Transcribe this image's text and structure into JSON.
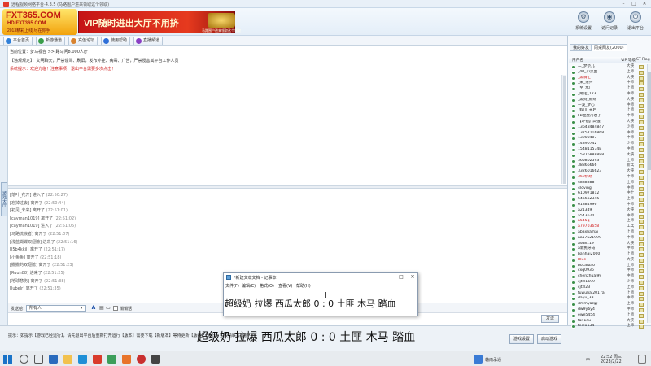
{
  "window": {
    "title": "远程视频网络平台-4.3.5 (马路围户进来领取这个领取)"
  },
  "logo": {
    "main": "FXT365.COM",
    "url": "HD.FXT365.COM",
    "sub": "2013精彩上线 尽在你手"
  },
  "ad_banner": {
    "text": "VIP随时进出大厅不用挤",
    "badge_caption": "马路围户进来领取这个领取"
  },
  "top_actions": [
    {
      "label": "系统设置",
      "icon": "gear-icon"
    },
    {
      "label": "访问记录",
      "icon": "record-icon"
    },
    {
      "label": "退出平台",
      "icon": "exit-icon"
    }
  ],
  "tabs": [
    {
      "label": "平台首页",
      "color": "#2f7fd8"
    },
    {
      "label": "新游通道",
      "color": "#3a9e4a"
    },
    {
      "label": "充值论坛",
      "color": "#d8832f"
    },
    {
      "label": "使用帮助",
      "color": "#2f6fd8"
    },
    {
      "label": "直播频道",
      "color": "#8a3fc4"
    }
  ],
  "left_side_tab": "游戏大厅",
  "chat": {
    "position": "当前位置：梦马视台 >> 路马问8.000人厅",
    "rules": "【违规规定】：文明聊天，严禁谩骂、刷屏，发布外挂、病毒、广告，严禁侵害其平台工作人员",
    "notice": "系统提示：欢迎光临！注意事项：退出平台需要多次点击！",
    "log": [
      {
        "name": "[落叶_花开]",
        "action": "进入了",
        "time": "(22:50:27)"
      },
      {
        "name": "[忘掉过去]",
        "action": "离开了",
        "time": "(22:50:44)"
      },
      {
        "name": "[初见_未来]",
        "action": "离开了",
        "time": "(22:51:01)"
      },
      {
        "name": "[cayman1019]",
        "action": "离开了",
        "time": "(22:51:02)"
      },
      {
        "name": "[cayman1019]",
        "action": "进入了",
        "time": "(22:51:05)"
      },
      {
        "name": "[马路流浪者]",
        "action": "离开了",
        "time": "(22:51:07)"
      },
      {
        "name": "[浅蓝蝴蝶双翅膀]",
        "action": "进来了",
        "time": "(22:51:16)"
      },
      {
        "name": "[l5b4kkjl]",
        "action": "离开了",
        "time": "(22:51:17)"
      },
      {
        "name": "[小鱼鱼]",
        "action": "离开了",
        "time": "(22:51:18)"
      },
      {
        "name": "[撒撒的双翅膀]",
        "action": "离开了",
        "time": "(22:51:23)"
      },
      {
        "name": "[Ruuh88]",
        "action": "进来了",
        "time": "(22:51:25)"
      },
      {
        "name": "[地球悲伤]",
        "action": "离开了",
        "time": "(22:51:38)"
      },
      {
        "name": "[lubelr]",
        "action": "离开了",
        "time": "(22:51:35)"
      }
    ]
  },
  "send_row": {
    "label": "发送给：",
    "target": "所有人",
    "private_label": "悄悄话",
    "send_button": "发送"
  },
  "bottom": {
    "tip": "提示：如提示【游戏已经运行】，请先退出平台后重新打开运行【版本】需要下载【新版本】等待更新【版本】【运行】失败请联系客服",
    "buttons": [
      "游戏设置",
      "启动游戏"
    ]
  },
  "right_panel": {
    "tabs": [
      "我的好友",
      "同桌网友(2000)"
    ],
    "headers": {
      "name": "用户名",
      "level": "VIP 等级",
      "status": "ST-Flag"
    },
    "users": [
      {
        "name": "二_梦奈儿",
        "level": "大侠",
        "red": false
      },
      {
        "name": "_40_小黑面",
        "level": "上师",
        "red": false
      },
      {
        "name": "_黑骑士",
        "level": "大侠",
        "red": true
      },
      {
        "name": "_某_余兴",
        "level": "中师",
        "red": false
      },
      {
        "name": "_至_水广",
        "level": "上师",
        "red": false
      },
      {
        "name": "_踢诺_123",
        "level": "中师",
        "red": false
      },
      {
        "name": "_黑狗_教练",
        "level": "大侠",
        "red": false
      },
      {
        "name": "一波_梦心",
        "level": "中师",
        "red": false
      },
      {
        "name": "_假川_天启",
        "level": "上师",
        "red": false
      },
      {
        "name": "FB金虎丹君子",
        "level": "中师",
        "red": false
      },
      {
        "name": "【环锁】高强",
        "level": "大侠",
        "red": false
      },
      {
        "name": "13648484847",
        "level": "少师",
        "red": false
      },
      {
        "name": "13757116868",
        "level": "中师",
        "red": false
      },
      {
        "name": "13900407",
        "level": "中师",
        "red": false
      },
      {
        "name": "14390742",
        "level": "少师",
        "red": false
      },
      {
        "name": "154811574B",
        "level": "中师",
        "red": false
      },
      {
        "name": "15876888888",
        "level": "大侠",
        "red": false
      },
      {
        "name": "365802593",
        "level": "上师",
        "red": false
      },
      {
        "name": "38866666",
        "level": "新兵",
        "red": false
      },
      {
        "name": "3326016623",
        "level": "大侠",
        "red": false
      },
      {
        "name": "369机场",
        "level": "中师",
        "red": true
      },
      {
        "name": "4888888",
        "level": "上师",
        "red": false
      },
      {
        "name": "4loving",
        "level": "中师",
        "red": false
      },
      {
        "name": "610971812",
        "level": "中士",
        "red": false
      },
      {
        "name": "646662345",
        "level": "上师",
        "red": false
      },
      {
        "name": "61884996",
        "level": "中师",
        "red": false
      },
      {
        "name": "a21349",
        "level": "大侠",
        "red": false
      },
      {
        "name": "a543620",
        "level": "中师",
        "red": false
      },
      {
        "name": "a545q",
        "level": "上师",
        "red": true
      },
      {
        "name": "a79703658",
        "level": "工兵",
        "red": true
      },
      {
        "name": "abaxhaihai",
        "level": "上师",
        "red": false
      },
      {
        "name": "aaa7521999",
        "level": "中师",
        "red": false
      },
      {
        "name": "asd8119",
        "level": "大侠",
        "red": false
      },
      {
        "name": "a新民牙马",
        "level": "中师",
        "red": false
      },
      {
        "name": "banhai2000",
        "level": "上师",
        "red": false
      },
      {
        "name": "Blue",
        "level": "大侠",
        "red": true
      },
      {
        "name": "bocaibao",
        "level": "上师",
        "red": false
      },
      {
        "name": "cxq0936",
        "level": "中师",
        "red": false
      },
      {
        "name": "chenzhuai99",
        "level": "中师",
        "red": false
      },
      {
        "name": "cjtzl1699",
        "level": "少师",
        "red": false
      },
      {
        "name": "cjtzl23",
        "level": "上师",
        "red": false
      },
      {
        "name": "fuwuhai2017a",
        "level": "上师",
        "red": false
      },
      {
        "name": "dayu_33",
        "level": "中师",
        "red": false
      },
      {
        "name": "dmmyac霸",
        "level": "上师",
        "red": false
      },
      {
        "name": "dw9y6y4",
        "level": "中师",
        "red": false
      },
      {
        "name": "ewe5454",
        "level": "上师",
        "red": false
      },
      {
        "name": "fan1du",
        "level": "大侠",
        "red": false
      },
      {
        "name": "feel1134",
        "level": "上师",
        "red": false
      }
    ]
  },
  "notepad": {
    "title": "*新建文本文档 - 记事本",
    "menu": [
      "文件(F)",
      "编辑(E)",
      "格式(O)",
      "查看(V)",
      "帮助(H)"
    ],
    "content": "超级奶 拉爆 西瓜太郎  0 : 0  土匪 木马 踏血"
  },
  "subtitle": "超级奶 拉爆 西瓜太郎  0 : 0  土匪 木马 踏血",
  "taskbar": {
    "ime": "中",
    "active_app": "韩雨承通",
    "time": "22:52 周三",
    "date": "2023/2/22"
  }
}
